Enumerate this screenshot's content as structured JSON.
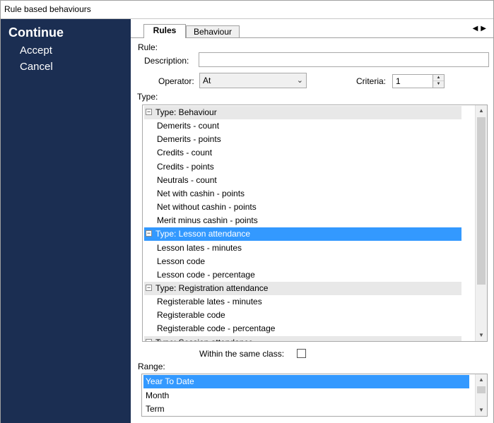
{
  "window": {
    "title": "Rule based behaviours"
  },
  "sidebar": {
    "title": "Continue",
    "accept": "Accept",
    "cancel": "Cancel"
  },
  "tabs": [
    {
      "label": "Rules",
      "active": true
    },
    {
      "label": "Behaviour",
      "active": false
    }
  ],
  "tab_scroll": {
    "left": "◀",
    "right": "▶"
  },
  "form": {
    "rule_label": "Rule:",
    "description_label": "Description:",
    "description_value": "",
    "operator_label": "Operator:",
    "operator_value": "At",
    "criteria_label": "Criteria:",
    "criteria_value": "1",
    "type_label": "Type:",
    "within_same_class_label": "Within the same class:",
    "within_same_class_checked": false,
    "range_label": "Range:"
  },
  "type_list": [
    {
      "kind": "group",
      "label": "Type:  Behaviour",
      "expander": "−"
    },
    {
      "kind": "item",
      "label": "Demerits - count"
    },
    {
      "kind": "item",
      "label": "Demerits - points"
    },
    {
      "kind": "item",
      "label": "Credits - count"
    },
    {
      "kind": "item",
      "label": "Credits - points"
    },
    {
      "kind": "item",
      "label": "Neutrals - count"
    },
    {
      "kind": "item",
      "label": "Net with cashin - points"
    },
    {
      "kind": "item",
      "label": "Net without cashin - points"
    },
    {
      "kind": "item",
      "label": "Merit minus cashin - points"
    },
    {
      "kind": "group",
      "label": "Type:  Lesson attendance",
      "expander": "−",
      "selected": true
    },
    {
      "kind": "item",
      "label": "Lesson lates - minutes"
    },
    {
      "kind": "item",
      "label": "Lesson code"
    },
    {
      "kind": "item",
      "label": "Lesson code - percentage"
    },
    {
      "kind": "group",
      "label": "Type:  Registration attendance",
      "expander": "−"
    },
    {
      "kind": "item",
      "label": "Registerable lates - minutes"
    },
    {
      "kind": "item",
      "label": "Registerable code"
    },
    {
      "kind": "item",
      "label": "Registerable code - percentage"
    },
    {
      "kind": "group",
      "label": "Type:  Session attendance",
      "expander": "−"
    }
  ],
  "range_list": [
    {
      "label": "Year To Date",
      "selected": true
    },
    {
      "label": "Month",
      "selected": false
    },
    {
      "label": "Term",
      "selected": false
    }
  ],
  "scrollbar_glyphs": {
    "up": "▲",
    "down": "▼"
  },
  "operator_caret": "⌄",
  "spin_glyphs": {
    "up": "▲",
    "down": "▼"
  }
}
